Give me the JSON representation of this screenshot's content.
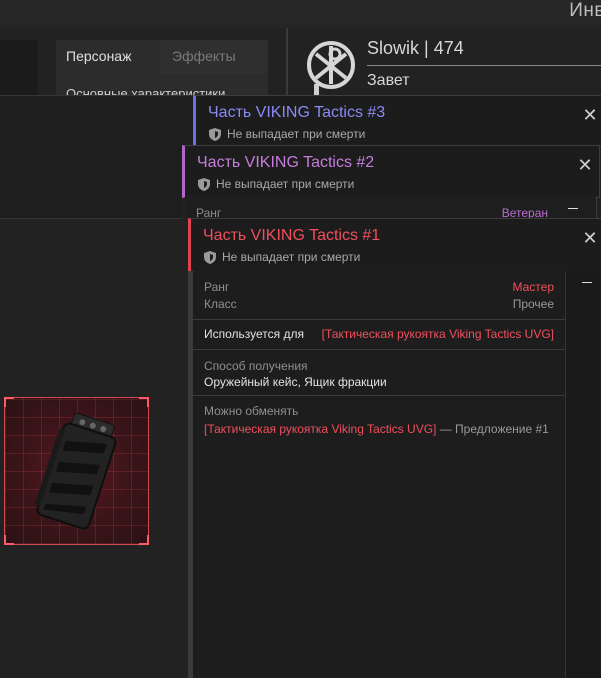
{
  "header": {
    "inventory_label": "Инв"
  },
  "character_panel": {
    "tab_character": "Персонаж",
    "tab_effects": "Эффекты",
    "basic_stats": "Основные характеристики"
  },
  "player": {
    "name": "Slowik | 474",
    "clan": "Завет"
  },
  "cards": [
    {
      "title": "Часть VIKING Tactics #3",
      "subtitle": "Не выпадает при смерти",
      "color": "#8a8af5"
    },
    {
      "title": "Часть VIKING Tactics #2",
      "subtitle": "Не выпадает при смерти",
      "color": "#c77ddb",
      "rank_label": "Ранг",
      "rank_value": "Ветеран"
    },
    {
      "title": "Часть VIKING Tactics #1",
      "subtitle": "Не выпадает при смерти",
      "color": "#f04f5c"
    }
  ],
  "details": {
    "rank_label": "Ранг",
    "rank_value": "Мастер",
    "class_label": "Класс",
    "class_value": "Прочее",
    "used_for_label": "Используется для",
    "used_for_value": "[Тактическая рукоятка Viking Tactics UVG]",
    "obtain_label": "Способ получения",
    "obtain_value": "Оружейный кейс, Ящик фракции",
    "exchange_label": "Можно обменять",
    "exchange_item": "[Тактическая рукоятка Viking Tactics UVG]",
    "exchange_suffix": "— Предложение #1"
  },
  "colors": {
    "accent_red": "#f04f5c",
    "accent_purple": "#c77ddb",
    "accent_blue": "#8a8af5"
  }
}
